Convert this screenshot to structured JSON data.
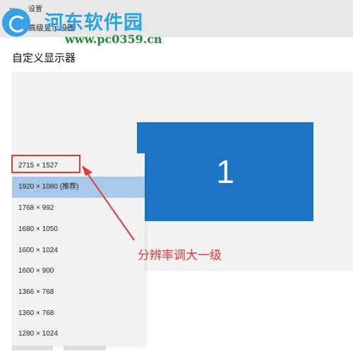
{
  "window": {
    "back_icon": "←",
    "title": "设置",
    "breadcrumb": "高级显示设置"
  },
  "watermark": {
    "title": "河东软件园",
    "url": "www.pc0359.cn",
    "logo_icon": "logo-icon"
  },
  "page": {
    "title": "自定义显示器"
  },
  "display": {
    "monitor_number": "1",
    "monitor_color": "#1d74c2"
  },
  "resolution_dropdown": {
    "options": [
      "2715 × 1527",
      "1920 × 1080 (推荐)",
      "1768 × 992",
      "1680 × 1050",
      "1600 × 1024",
      "1600 × 900",
      "1366 × 768",
      "1360 × 768",
      "1280 × 1024"
    ],
    "selected_index": 1,
    "highlighted_index": 0,
    "highlight_color": "#e53935"
  },
  "annotation": {
    "text": "分辨率调大一级",
    "color": "#e53935"
  }
}
